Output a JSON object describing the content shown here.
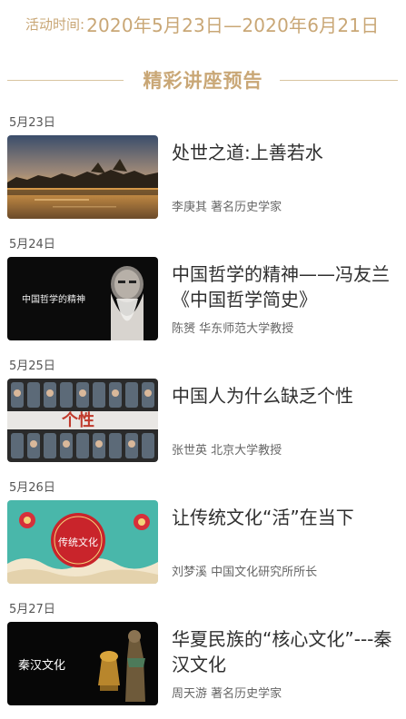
{
  "header": {
    "activity_label": "活动时间:",
    "activity_range": "2020年5月23日—2020年6月21日",
    "section_title": "精彩讲座预告",
    "accent_color": "#c9a776"
  },
  "lectures": [
    {
      "date": "5月23日",
      "title": "处世之道:上善若水",
      "speaker": "李庚其 著名历史学家",
      "thumb_icon": "lake-sunset-image",
      "thumb_text": ""
    },
    {
      "date": "5月24日",
      "title": "中国哲学的精神——冯友兰《中国哲学简史》",
      "speaker": "陈赟 华东师范大学教授",
      "thumb_icon": "philosopher-portrait-image",
      "thumb_text": "中国哲学的精神"
    },
    {
      "date": "5月25日",
      "title": "中国人为什么缺乏个性",
      "speaker": "张世英 北京大学教授",
      "thumb_icon": "subway-passengers-image",
      "thumb_text": "个性"
    },
    {
      "date": "5月26日",
      "title": "让传统文化“活”在当下",
      "speaker": "刘梦溪 中国文化研究所所长",
      "thumb_icon": "traditional-culture-image",
      "thumb_text": "传统文化"
    },
    {
      "date": "5月27日",
      "title": "华夏民族的“核心文化”---秦汉文化",
      "speaker": "周天游 著名历史学家",
      "thumb_icon": "qin-han-artifacts-image",
      "thumb_text": "秦汉文化"
    }
  ]
}
